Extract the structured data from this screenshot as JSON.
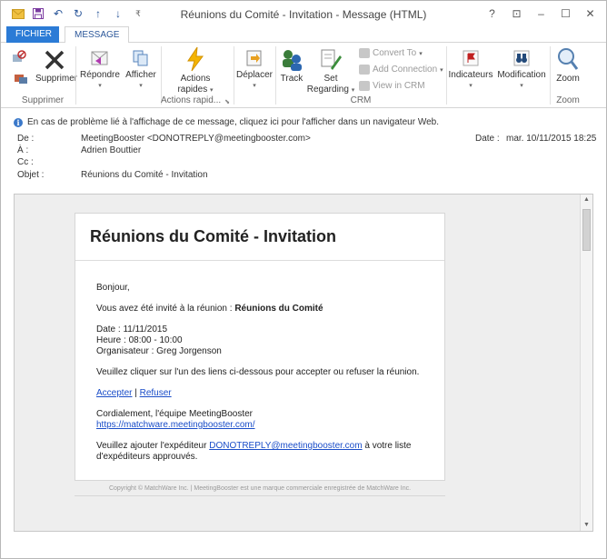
{
  "window": {
    "title": "Réunions du Comité - Invitation - Message (HTML)"
  },
  "qat": {
    "icons": [
      "mail-icon",
      "save-icon",
      "undo-icon",
      "redo-icon",
      "up-arrow-icon",
      "down-arrow-icon",
      "customize-icon"
    ]
  },
  "winctl": {
    "help": "?",
    "ribbon": "⊡",
    "min": "–",
    "max": "☐",
    "close": "✕"
  },
  "tabs": {
    "file": "FICHIER",
    "message": "MESSAGE"
  },
  "ribbon": {
    "supprimer": {
      "button": "Supprimer",
      "group": "Supprimer"
    },
    "repondre": "Répondre",
    "afficher": "Afficher",
    "actions_rapides": {
      "line1": "Actions",
      "line2": "rapides",
      "group": "Actions rapid..."
    },
    "deplacer": "Déplacer",
    "track": "Track",
    "set_regarding": {
      "line1": "Set",
      "line2": "Regarding"
    },
    "convert_to": "Convert To",
    "add_connection": "Add Connection",
    "view_in_crm": "View in CRM",
    "crm_group": "CRM",
    "indicateurs": "Indicateurs",
    "modification": "Modification",
    "zoom": {
      "button": "Zoom",
      "group": "Zoom"
    }
  },
  "infobar": "En cas de problème lié à l'affichage de ce message, cliquez ici pour l'afficher dans un navigateur Web.",
  "headers": {
    "de_label": "De :",
    "de_value": "MeetingBooster <DONOTREPLY@meetingbooster.com>",
    "a_label": "À :",
    "a_value": "Adrien Bouttier",
    "cc_label": "Cc :",
    "cc_value": "",
    "objet_label": "Objet :",
    "objet_value": "Réunions du Comité  - Invitation",
    "date_label": "Date :",
    "date_value": "mar. 10/11/2015 18:25"
  },
  "email": {
    "title": "Réunions du Comité - Invitation",
    "greeting": "Bonjour,",
    "invite_prefix": "Vous avez été invité à la réunion : ",
    "invite_meeting": "Réunions du Comité",
    "date_line": "Date : 11/11/2015",
    "heure_line": "Heure : 08:00 - 10:00",
    "organisateur_line": "Organisateur : Greg Jorgenson",
    "instruction": "Veuillez cliquer sur l'un des liens ci-dessous pour accepter ou refuser la réunion.",
    "accept": "Accepter",
    "link_sep": " | ",
    "refuse": "Refuser",
    "regards": "Cordialement, l'équipe MeetingBooster",
    "site_link": "https://matchware.meetingbooster.com/",
    "safe_prefix": "Veuillez ajouter l'expéditeur ",
    "safe_email": "DONOTREPLY@meetingbooster.com",
    "safe_suffix": " à votre liste d'expéditeurs approuvés."
  },
  "footer": "Copyright © MatchWare Inc. | MeetingBooster est une marque commerciale enregistrée de MatchWare Inc."
}
